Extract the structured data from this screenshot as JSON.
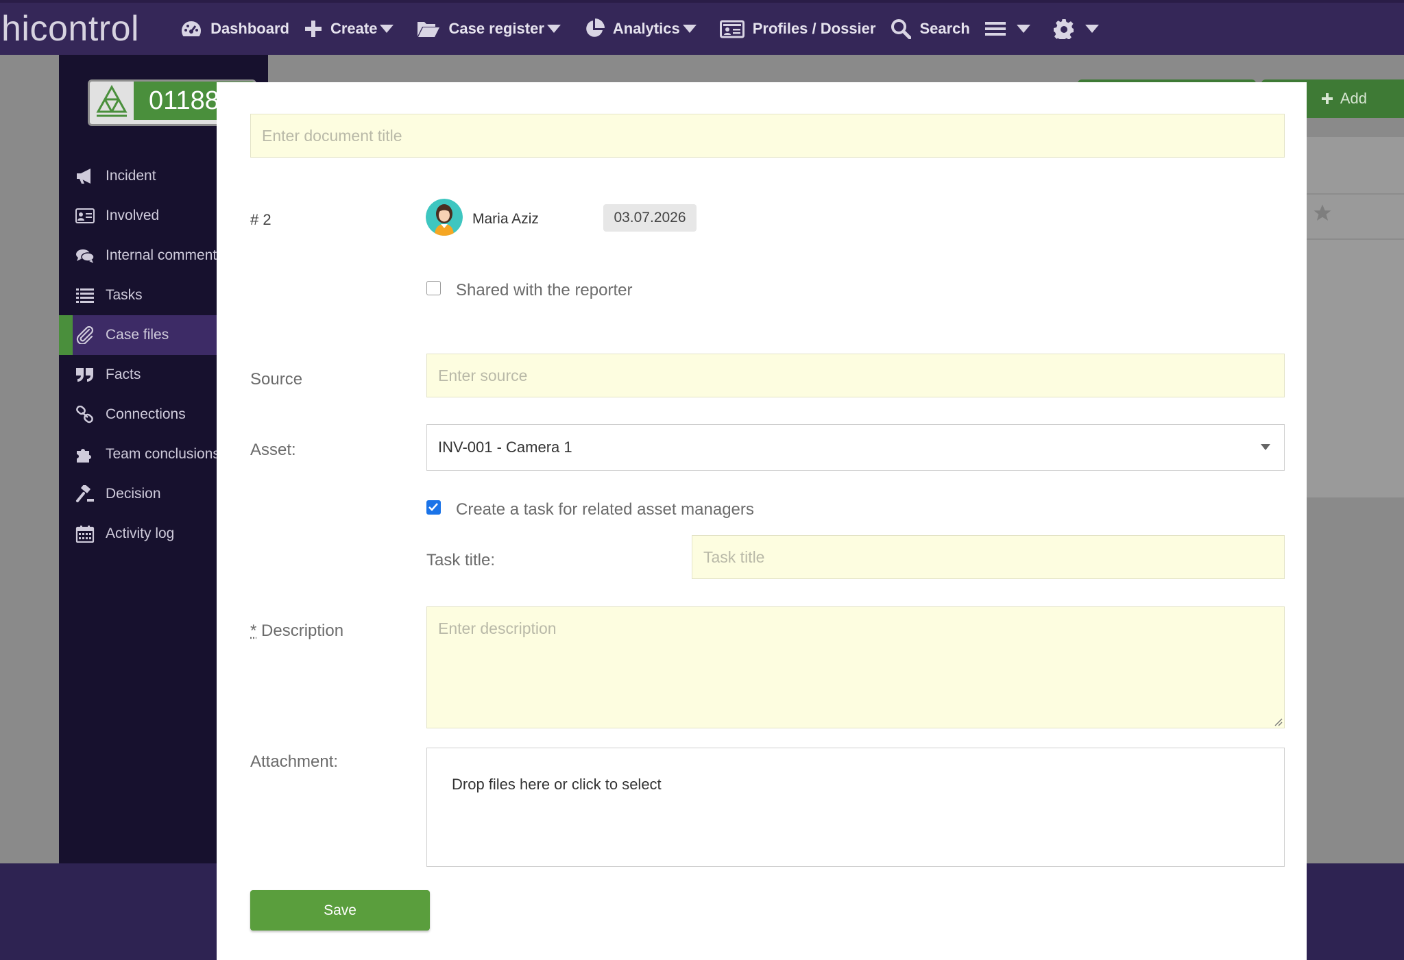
{
  "nav": {
    "brand": "hicontrol",
    "items": [
      {
        "label": "Dashboard",
        "icon": "dashboard-icon"
      },
      {
        "label": "Create",
        "icon": "plus-icon"
      },
      {
        "label": "Case register",
        "icon": "folder-icon"
      },
      {
        "label": "Analytics",
        "icon": "pie-chart-icon"
      },
      {
        "label": "Profiles / Dossier",
        "icon": "id-card-icon"
      },
      {
        "label": "Search",
        "icon": "search-icon"
      }
    ]
  },
  "sidebar": {
    "case_number": "01188",
    "items": [
      {
        "label": "Incident",
        "icon": "megaphone-icon"
      },
      {
        "label": "Involved",
        "icon": "id-card-icon"
      },
      {
        "label": "Internal comments",
        "icon": "comments-icon"
      },
      {
        "label": "Tasks",
        "icon": "list-icon"
      },
      {
        "label": "Case files",
        "icon": "paperclip-icon",
        "active": true
      },
      {
        "label": "Facts",
        "icon": "quote-icon"
      },
      {
        "label": "Connections",
        "icon": "link-icon"
      },
      {
        "label": "Team conclusions",
        "icon": "puzzle-icon"
      },
      {
        "label": "Decision",
        "icon": "gavel-icon"
      },
      {
        "label": "Activity log",
        "icon": "calendar-icon"
      }
    ]
  },
  "background": {
    "add_label": "Add"
  },
  "form": {
    "title_placeholder": "Enter document title",
    "doc_number": "# 2",
    "author": "Maria Aziz",
    "date": "03.07.2026",
    "shared_label": "Shared with the reporter",
    "shared_checked": false,
    "source_label": "Source",
    "source_placeholder": "Enter source",
    "asset_label": "Asset:",
    "asset_value": "INV-001 - Camera 1",
    "create_task_label": "Create a task for related asset managers",
    "create_task_checked": true,
    "task_title_label": "Task title:",
    "task_title_placeholder": "Task title",
    "description_required_mark": "*",
    "description_label": "Description",
    "description_placeholder": "Enter description",
    "attachment_label": "Attachment:",
    "dropzone_text": "Drop files here or click to select",
    "save_label": "Save"
  },
  "colors": {
    "nav_bg": "#352758",
    "sidebar_bg": "#17112e",
    "accent_green": "#5a9e3d",
    "input_bg": "#fdfde0",
    "checkbox_blue": "#1a73e8"
  }
}
